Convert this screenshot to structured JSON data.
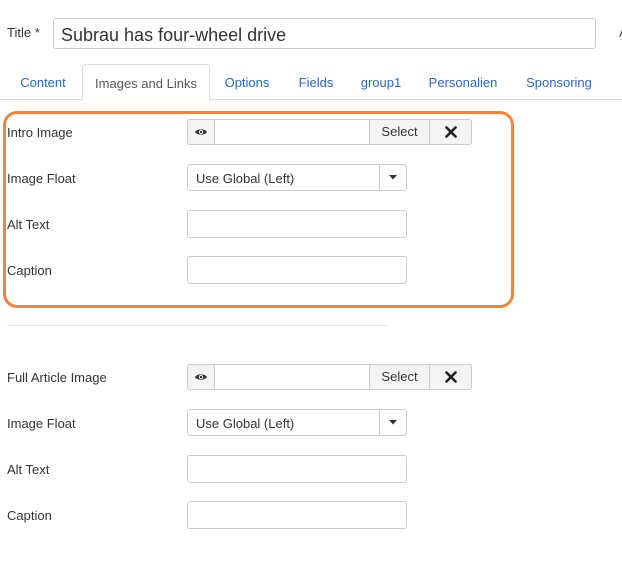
{
  "title": {
    "label": "Title *",
    "value": "Subrau has four-wheel drive",
    "extra": "A"
  },
  "tabs": [
    {
      "label": "Content"
    },
    {
      "label": "Images and Links",
      "active": true
    },
    {
      "label": "Options"
    },
    {
      "label": "Fields"
    },
    {
      "label": "group1"
    },
    {
      "label": "Personalien"
    },
    {
      "label": "Sponsoring"
    }
  ],
  "intro": {
    "image_label": "Intro Image",
    "select_label": "Select",
    "float_label": "Image Float",
    "float_value": "Use Global (Left)",
    "alt_label": "Alt Text",
    "caption_label": "Caption"
  },
  "full": {
    "image_label": "Full Article Image",
    "select_label": "Select",
    "float_label": "Image Float",
    "float_value": "Use Global (Left)",
    "alt_label": "Alt Text",
    "caption_label": "Caption"
  },
  "colors": {
    "link": "#2a69b8",
    "highlight": "#f0843d",
    "border": "#cccccc"
  },
  "icons": [
    "eye-icon",
    "close-x-icon",
    "caret-down-icon"
  ]
}
